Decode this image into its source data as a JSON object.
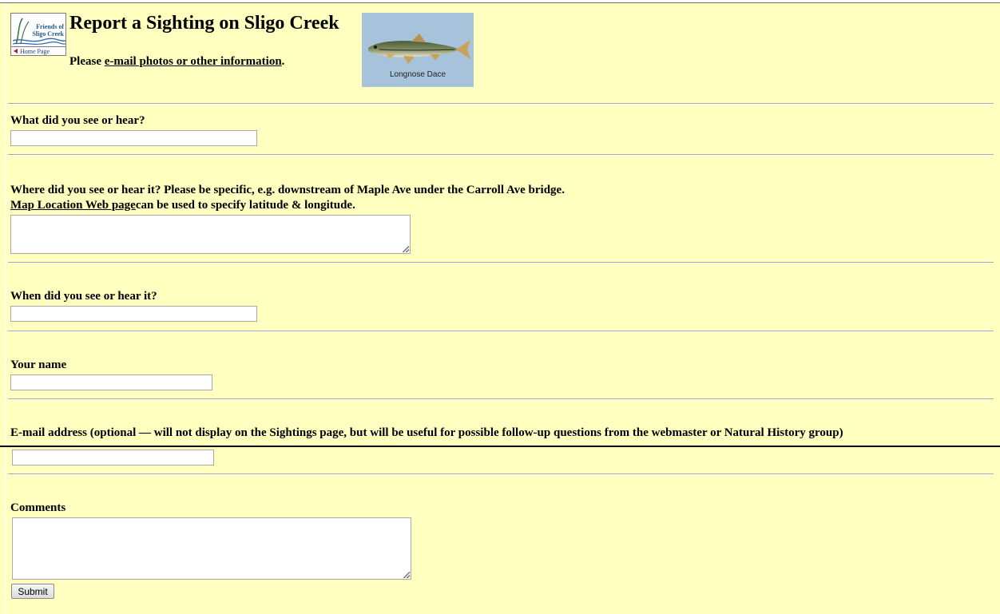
{
  "header": {
    "logo": {
      "line1": "Friends of",
      "line2": "Sligo Creek",
      "home_label": "Home Page"
    },
    "title": "Report a Sighting on Sligo Creek",
    "subtitle_prefix": "Please ",
    "subtitle_link": "e-mail photos or other information",
    "subtitle_suffix": ".",
    "image_caption": "Longnose Dace"
  },
  "form": {
    "what": {
      "label": "What did you see or hear?",
      "value": ""
    },
    "where": {
      "label": "Where did you see or hear it? Please be specific, e.g. downstream of Maple Ave under the Carroll Ave bridge.",
      "map_link": "Map Location Web page",
      "map_suffix": "can be used to specify latitude & longitude.",
      "value": ""
    },
    "when": {
      "label": "When did you see or hear it?",
      "value": ""
    },
    "name": {
      "label": "Your name",
      "value": ""
    },
    "email": {
      "label": "E-mail address (optional — will not display on the Sightings page, but will be useful for possible follow-up questions from the webmaster or Natural History group)",
      "value": ""
    },
    "comments": {
      "label": "Comments",
      "value": ""
    },
    "submit_label": "Submit"
  },
  "colors": {
    "page_background": "#ffffc0",
    "fish_background": "#a7c3dc",
    "logo_text": "#1f5a8a",
    "home_arrow": "#c8102e"
  }
}
